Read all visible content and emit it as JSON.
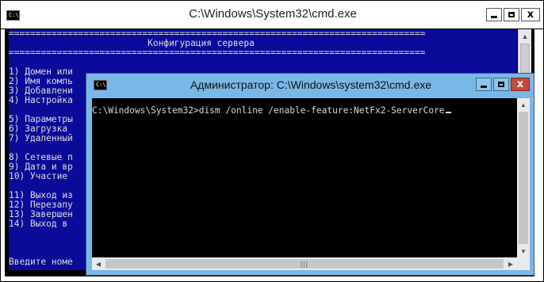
{
  "back_window": {
    "title": "C:\\Windows\\System32\\cmd.exe",
    "icon_label": "C:\\",
    "console_lines": [
      "==============================================================================",
      "                          Конфигурация сервера",
      "==============================================================================",
      "",
      "1) Домен или",
      "2) Имя компь",
      "3) Добавлени",
      "4) Настройка",
      "",
      "5) Параметры",
      "6) Загрузка",
      "7) Удаленный",
      "",
      "8) Сетевые п",
      "9) Дата и вр",
      "10) Участие",
      "",
      "11) Выход из",
      "12) Перезапу",
      "13) Завершен",
      "14) Выход в",
      "",
      "",
      "",
      "Введите номе"
    ]
  },
  "front_window": {
    "title": "Администратор: C:\\Windows\\system32\\cmd.exe",
    "icon_label": "C:\\",
    "command_line": "C:\\Windows\\System32>dism /online /enable-feature:NetFx2-ServerCore"
  },
  "icons": {
    "minimize": "minimize-icon",
    "maximize": "maximize-icon",
    "close": "close-icon",
    "close_glyph": "x"
  },
  "colors": {
    "sconfig_background": "#0b0b9a",
    "active_titlebar": "#79b7e6",
    "close_button": "#c9463d"
  }
}
